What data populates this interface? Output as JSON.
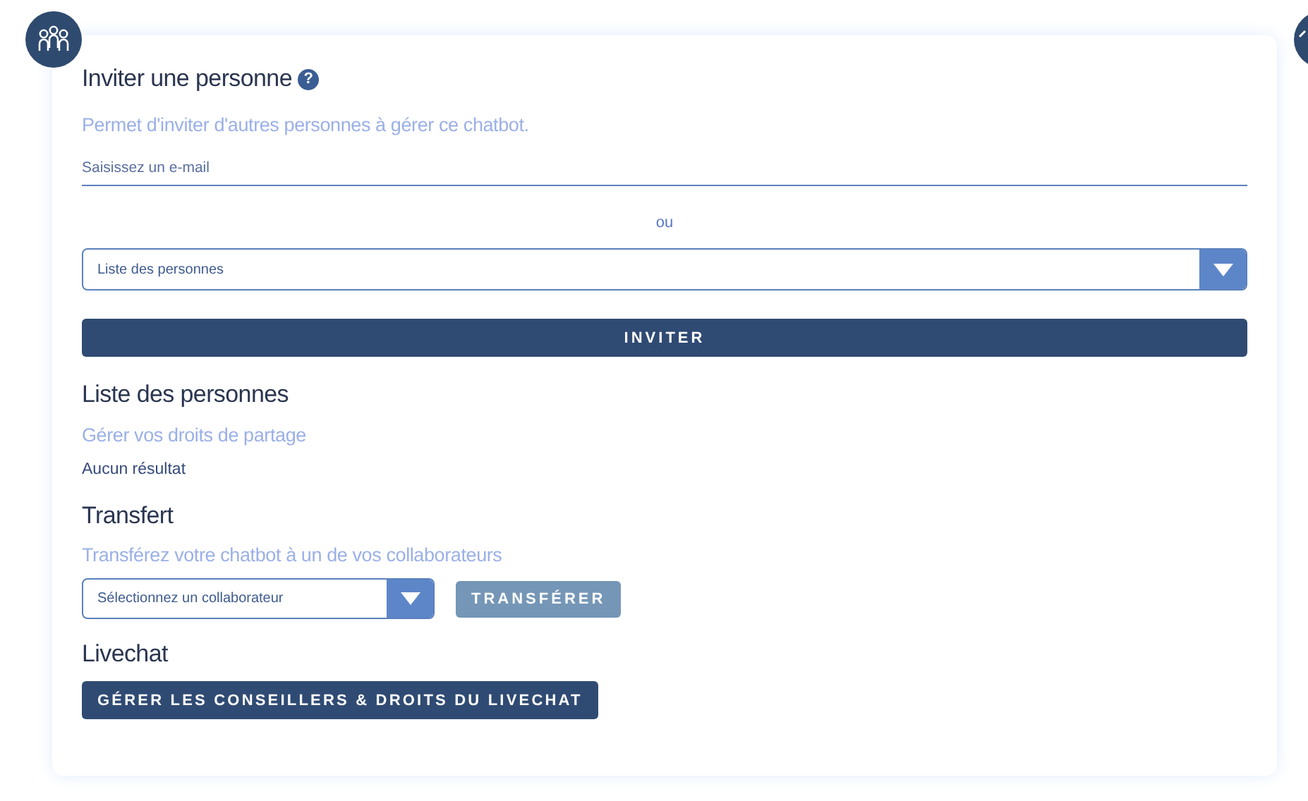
{
  "invite": {
    "title": "Inviter une personne",
    "help": "?",
    "description": "Permet d'inviter d'autres personnes à gérer ce chatbot.",
    "email_field": {
      "placeholder": "Saisissez un e-mail"
    },
    "separator": "ou",
    "people_select": {
      "placeholder": "Liste des personnes"
    },
    "button": "INVITER"
  },
  "people": {
    "title": "Liste des personnes",
    "description": "Gérer vos droits de partage",
    "empty": "Aucun résultat"
  },
  "transfer": {
    "title": "Transfert",
    "description": "Transférez votre chatbot à un de vos collaborateurs",
    "select": {
      "placeholder": "Sélectionnez un collaborateur"
    },
    "button": {
      "label": "TRANSFÉRER",
      "disabled": true
    }
  },
  "livechat": {
    "title": "Livechat",
    "button": "GÉRER LES CONSEILLERS & DROITS DU LIVECHAT"
  }
}
